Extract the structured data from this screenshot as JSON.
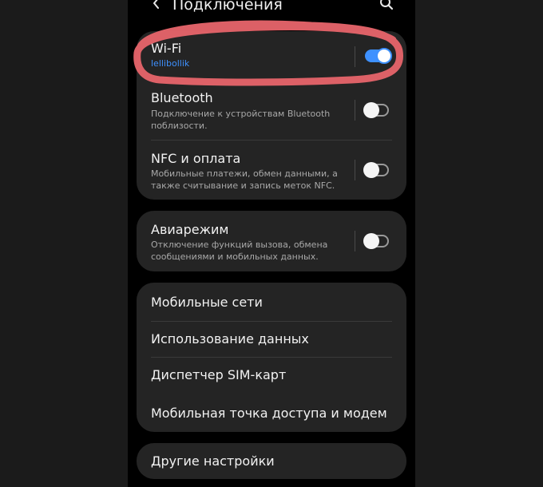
{
  "header": {
    "back_icon": "chevron-left-icon",
    "title": "Подключения",
    "search_icon": "search-icon"
  },
  "connections": [
    {
      "title": "Wi-Fi",
      "subtitle": "lellibollik",
      "toggle_on": true
    },
    {
      "title": "Bluetooth",
      "subtitle": "Подключение к устройствам Bluetooth поблизости.",
      "toggle_on": false
    },
    {
      "title": "NFC и оплата",
      "subtitle": "Мобильные платежи, обмен данными, а также считывание и запись меток NFC.",
      "toggle_on": false
    }
  ],
  "airplane": {
    "title": "Авиарежим",
    "subtitle": "Отключение функций вызова, обмена сообщениями и мобильных данных.",
    "toggle_on": false
  },
  "network_items": [
    {
      "label": "Мобильные сети"
    },
    {
      "label": "Использование данных"
    },
    {
      "label": "Диспетчер SIM-карт"
    },
    {
      "label": "Мобильная точка доступа и модем"
    }
  ],
  "more": {
    "label": "Другие настройки"
  },
  "colors": {
    "accent": "#3e91ff",
    "card_bg": "#242424",
    "marker": "#e8656c"
  }
}
